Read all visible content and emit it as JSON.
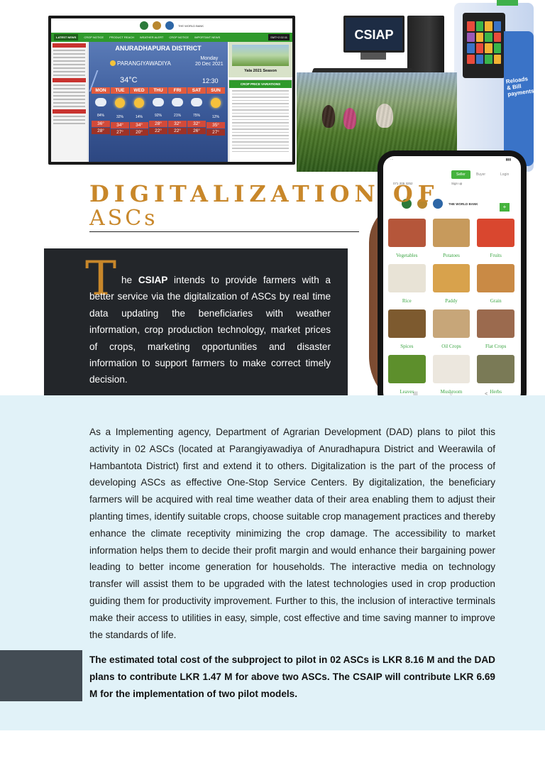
{
  "collage": {
    "monitor": {
      "logo_caption": "THE WORLD BANK",
      "ticker": {
        "news_label": "LATEST NEWS",
        "items": [
          "CROP NOTICE",
          "PRODUCT REACH",
          "WEATHER ALERT",
          "CROP NOTICE",
          "IMPORTANT NEWS"
        ],
        "date_chip": "SMT+2 02:11"
      },
      "weather": {
        "district": "ANURADHAPURA DISTRICT",
        "location": "PARANGIYAWADIYA",
        "day": "Monday",
        "date": "20 Dec 2021",
        "temperature": "34°C",
        "time": "12:30",
        "forecast": [
          {
            "day": "MON",
            "icon": "cloud-rain-icon",
            "humidity": "84%",
            "high": "36°",
            "low": "28°"
          },
          {
            "day": "TUE",
            "icon": "sun-icon",
            "humidity": "32%",
            "high": "34°",
            "low": "27°"
          },
          {
            "day": "WED",
            "icon": "sun-icon",
            "humidity": "14%",
            "high": "34°",
            "low": "20°"
          },
          {
            "day": "THU",
            "icon": "cloud-rain-icon",
            "humidity": "92%",
            "high": "28°",
            "low": "22°"
          },
          {
            "day": "FRI",
            "icon": "cloud-rain-icon",
            "humidity": "21%",
            "high": "32°",
            "low": "22°"
          },
          {
            "day": "SAT",
            "icon": "cloud-rain-icon",
            "humidity": "75%",
            "high": "32°",
            "low": "26°"
          },
          {
            "day": "SUN",
            "icon": "sun-icon",
            "humidity": "12%",
            "high": "35°",
            "low": "27°"
          }
        ]
      },
      "season_title": "Yala 2021 Season",
      "prices_title": "CROP PRICE VARIATIONS"
    },
    "desktop_label": "CSIAP",
    "kiosk_label": "Reloads & Bill payments",
    "phone": {
      "seller": "Seller",
      "buyer": "Buyer",
      "login": "Login",
      "phone_number": "071 205 3252",
      "sign_up": "Sign up",
      "world_bank": "THE WORLD BANK",
      "plus": "+",
      "tiles": [
        {
          "label": "Vegetables",
          "color": "#b5563a"
        },
        {
          "label": "Potatoes",
          "color": "#c79a5c"
        },
        {
          "label": "Fruits",
          "color": "#d9472f"
        },
        {
          "label": "Rice",
          "color": "#e8e3d6"
        },
        {
          "label": "Paddy",
          "color": "#d8a24c"
        },
        {
          "label": "Grain",
          "color": "#c98a45"
        },
        {
          "label": "Spices",
          "color": "#7d5a2f"
        },
        {
          "label": "Oil Crops",
          "color": "#c7a679"
        },
        {
          "label": "Flat Crops",
          "color": "#9b6a4e"
        },
        {
          "label": "Leaves",
          "color": "#5d8f2c"
        },
        {
          "label": "Mushroom",
          "color": "#ece7de"
        },
        {
          "label": "Herbs",
          "color": "#7a7a56"
        }
      ],
      "nav": [
        "|||",
        "○",
        "<"
      ]
    }
  },
  "heading": {
    "line1": "DIGITALIZATION OF",
    "line2": "ASCs"
  },
  "intro": {
    "dropcap": "T",
    "lead": "he ",
    "bold": "CSIAP",
    "rest": " intends to provide farmers with a better service via the digitalization of ASCs by real time data  updating the beneficiaries with weather information, crop production technology, market prices of crops, marketing opportunities and disaster information to support farmers to make correct timely decision."
  },
  "body": "As a Implementing agency, Department of Agrarian Development (DAD) plans to pilot this activity in 02 ASCs (located at Parangiyawadiya of Anuradhapura District and Weerawila of Hambantota District) first and extend it to others. Digitalization is the part of the process of developing ASCs as effective One-Stop Service Centers. By digitalization, the beneficiary farmers will be acquired with real time weather data of their area enabling them to adjust their planting times, identify suitable crops, choose suitable crop management practices and thereby enhance the climate receptivity minimizing the crop damage. The accessibility to market information helps them to decide their profit margin and would enhance their bargaining power leading to better income generation for households. The interactive media on technology transfer will assist them to be upgraded with the latest technologies used in crop production guiding them for productivity improvement. Further to this, the inclusion of interactive terminals make their access to utilities in easy, simple, cost effective and time saving manner to improve the standards of life.",
  "cost": "The estimated total cost of the subproject to pilot in 02 ASCs is LKR 8.16 M and the DAD plans to contribute LKR 1.47 M for above two ASCs. The CSAIP will contribute LKR 6.69 M for the implementation of  two pilot models.",
  "colors": {
    "heading": "#c8872a",
    "dark_box": "#23262a",
    "band": "#e1f2f8",
    "grey_block": "#434c54",
    "green": "#45b33d"
  }
}
